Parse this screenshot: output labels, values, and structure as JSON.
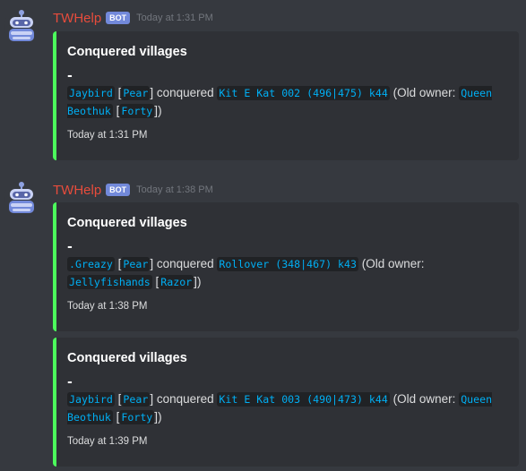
{
  "messages": [
    {
      "username": "TWHelp",
      "badge": "BOT",
      "timestamp": "Today at 1:31 PM",
      "embeds": [
        {
          "title": "Conquered villages",
          "dash": "-",
          "new_owner": "Jaybird",
          "new_tribe": "Pear",
          "verb": "conquered",
          "village": "Kit E Kat 002 (496|475) k44",
          "old_owner_label": "(Old owner:",
          "old_owner": "Queen Beothuk",
          "old_tribe": "Forty",
          "close": ")",
          "footer": "Today at 1:31 PM"
        }
      ]
    },
    {
      "username": "TWHelp",
      "badge": "BOT",
      "timestamp": "Today at 1:38 PM",
      "embeds": [
        {
          "title": "Conquered villages",
          "dash": "-",
          "new_owner": ".Greazy",
          "new_tribe": "Pear",
          "verb": "conquered",
          "village": "Rollover (348|467) k43",
          "old_owner_label": "(Old owner:",
          "old_owner": "Jellyfishands",
          "old_tribe": "Razor",
          "close": ")",
          "footer": "Today at 1:38 PM"
        },
        {
          "title": "Conquered villages",
          "dash": "-",
          "new_owner": "Jaybird",
          "new_tribe": "Pear",
          "verb": "conquered",
          "village": "Kit E Kat 003 (490|473) k44",
          "old_owner_label": "(Old owner:",
          "old_owner": "Queen Beothuk",
          "old_tribe": "Forty",
          "close": ")",
          "footer": "Today at 1:39 PM"
        }
      ]
    }
  ],
  "colors": {
    "background": "#36393f",
    "embed_bg": "#2f3136",
    "embed_accent": "#4cfc5c",
    "username": "#e74c3c",
    "badge": "#7289da",
    "code_text": "#00aff4"
  },
  "icons": {
    "avatar": "robot-avatar-icon"
  }
}
